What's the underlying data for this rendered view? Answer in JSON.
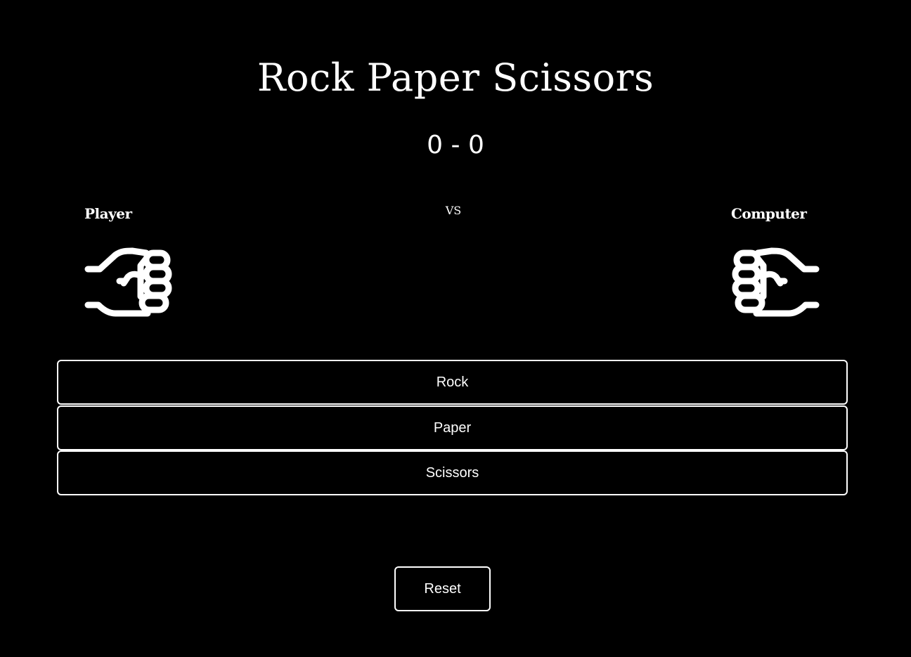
{
  "header": {
    "title": "Rock Paper Scissors"
  },
  "scoreboard": {
    "score": "0 - 0"
  },
  "arena": {
    "player_label": "Player",
    "vs_label": "VS",
    "computer_label": "Computer",
    "player_hand_icon": "rock-fist-icon",
    "computer_hand_icon": "rock-fist-icon"
  },
  "choices": {
    "rock": "Rock",
    "paper": "Paper",
    "scissors": "Scissors"
  },
  "controls": {
    "reset": "Reset"
  },
  "colors": {
    "background": "#000000",
    "foreground": "#ffffff"
  }
}
